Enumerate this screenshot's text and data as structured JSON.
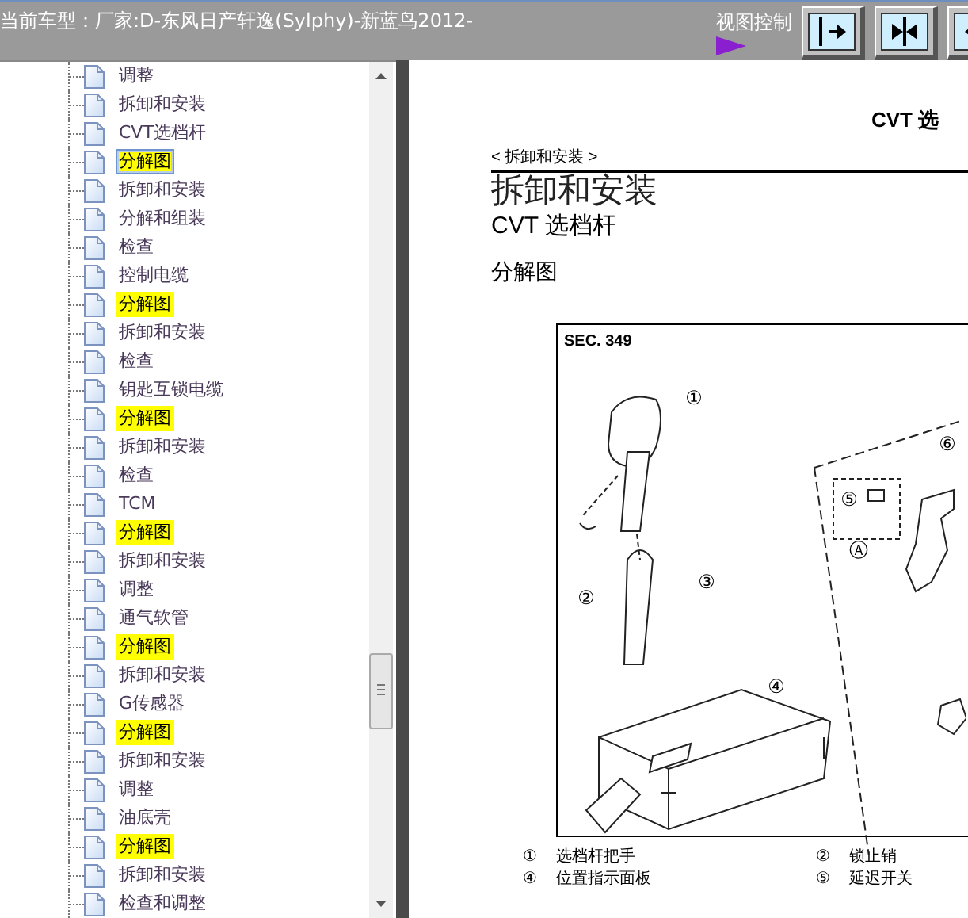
{
  "header": {
    "model_label": "当前车型：厂家:D-东风日产轩逸(Sylphy)-新蓝鸟2012-",
    "view_control_label": "视图控制",
    "view_buttons": [
      {
        "kind": "expand-right"
      },
      {
        "kind": "collapse"
      },
      {
        "kind": "expand-left"
      }
    ]
  },
  "tree": {
    "items": [
      {
        "label": "调整",
        "highlighted": false,
        "selected": false
      },
      {
        "label": "拆卸和安装",
        "highlighted": false,
        "selected": false
      },
      {
        "label": "CVT选档杆",
        "highlighted": false,
        "selected": false
      },
      {
        "label": "分解图",
        "highlighted": true,
        "selected": true
      },
      {
        "label": "拆卸和安装",
        "highlighted": false,
        "selected": false
      },
      {
        "label": "分解和组装",
        "highlighted": false,
        "selected": false
      },
      {
        "label": "检查",
        "highlighted": false,
        "selected": false
      },
      {
        "label": "控制电缆",
        "highlighted": false,
        "selected": false
      },
      {
        "label": "分解图",
        "highlighted": true,
        "selected": false
      },
      {
        "label": "拆卸和安装",
        "highlighted": false,
        "selected": false
      },
      {
        "label": "检查",
        "highlighted": false,
        "selected": false
      },
      {
        "label": "钥匙互锁电缆",
        "highlighted": false,
        "selected": false
      },
      {
        "label": "分解图",
        "highlighted": true,
        "selected": false
      },
      {
        "label": "拆卸和安装",
        "highlighted": false,
        "selected": false
      },
      {
        "label": "检查",
        "highlighted": false,
        "selected": false
      },
      {
        "label": "TCM",
        "highlighted": false,
        "selected": false
      },
      {
        "label": "分解图",
        "highlighted": true,
        "selected": false
      },
      {
        "label": "拆卸和安装",
        "highlighted": false,
        "selected": false
      },
      {
        "label": "调整",
        "highlighted": false,
        "selected": false
      },
      {
        "label": "通气软管",
        "highlighted": false,
        "selected": false
      },
      {
        "label": "分解图",
        "highlighted": true,
        "selected": false
      },
      {
        "label": "拆卸和安装",
        "highlighted": false,
        "selected": false
      },
      {
        "label": "G传感器",
        "highlighted": false,
        "selected": false
      },
      {
        "label": "分解图",
        "highlighted": true,
        "selected": false
      },
      {
        "label": "拆卸和安装",
        "highlighted": false,
        "selected": false
      },
      {
        "label": "调整",
        "highlighted": false,
        "selected": false
      },
      {
        "label": "油底壳",
        "highlighted": false,
        "selected": false
      },
      {
        "label": "分解图",
        "highlighted": true,
        "selected": false
      },
      {
        "label": "拆卸和安装",
        "highlighted": false,
        "selected": false
      },
      {
        "label": "检查和调整",
        "highlighted": false,
        "selected": false
      }
    ]
  },
  "document": {
    "running_header": "CVT 选",
    "breadcrumb": "< 拆卸和安装 >",
    "title": "拆卸和安装",
    "subtitle": "CVT 选档杆",
    "section": "分解图",
    "figure": {
      "section_code": "SEC. 349",
      "callouts": [
        {
          "label": "①"
        },
        {
          "label": "②"
        },
        {
          "label": "③"
        },
        {
          "label": "④"
        },
        {
          "label": "⑤"
        },
        {
          "label": "⑥"
        },
        {
          "label": "Ⓐ"
        }
      ]
    },
    "legend": [
      {
        "number": "①",
        "text": "选档杆把手"
      },
      {
        "number": "②",
        "text": "锁止销"
      },
      {
        "number": "④",
        "text": "位置指示面板"
      },
      {
        "number": "⑤",
        "text": "延迟开关"
      }
    ]
  }
}
